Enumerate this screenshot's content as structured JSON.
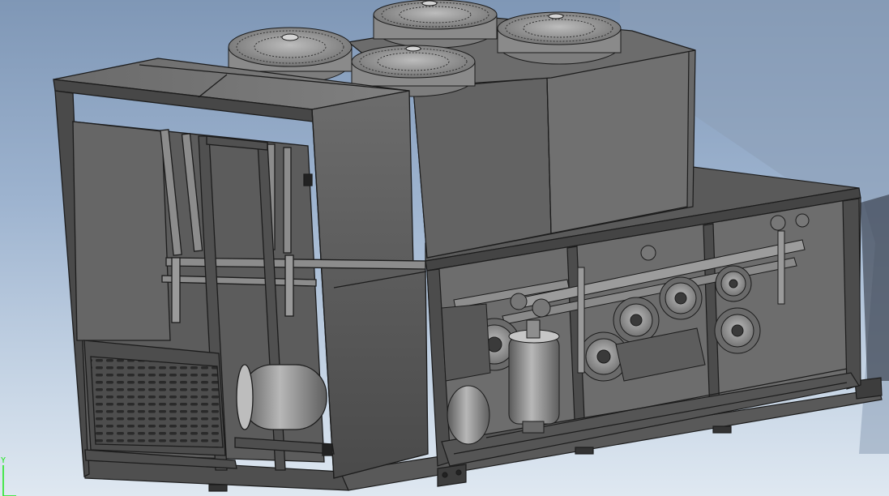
{
  "viewport": {
    "content": "cad-assembly-3d-view",
    "background_top": "#7f97b6",
    "background_bottom": "#dfe8f1"
  },
  "model": {
    "body_color": "#5a5a5a",
    "edge_color": "#1c1c1c",
    "fan_count": 4,
    "compressor_count": 6
  },
  "triad": {
    "y_axis_label": "Y",
    "axis_color": "#19e619"
  }
}
